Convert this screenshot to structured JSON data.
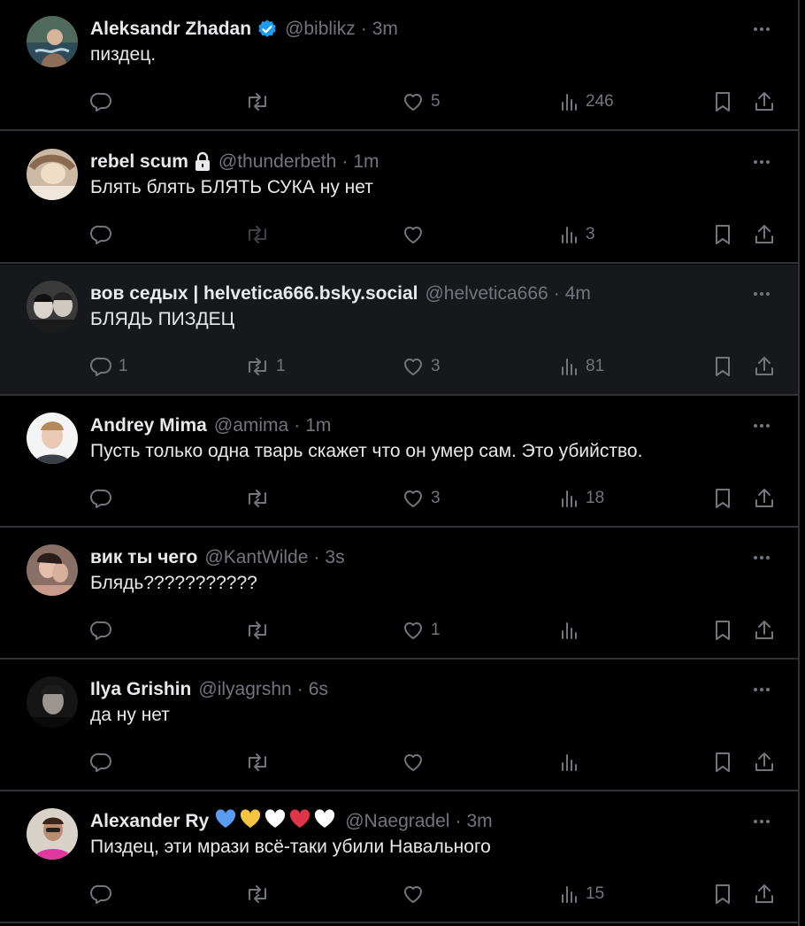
{
  "tweets": [
    {
      "name": "Aleksandr Zhadan",
      "badge": "verified",
      "handle": "@biblikz",
      "time": "3m",
      "text": "пиздец.",
      "replies": "",
      "retweets": "",
      "likes": "5",
      "views": "246",
      "rt_dim": false,
      "highlighted": false
    },
    {
      "name": "rebel scum",
      "badge": "lock",
      "handle": "@thunderbeth",
      "time": "1m",
      "text": "Блять блять БЛЯТЬ СУКА ну нет",
      "replies": "",
      "retweets": "",
      "likes": "",
      "views": "3",
      "rt_dim": true,
      "highlighted": false
    },
    {
      "name": "вов седых | helvetica666.bsky.social",
      "badge": "",
      "handle": "@helvetica666",
      "time": "4m",
      "text": "БЛЯДЬ ПИЗДЕЦ",
      "replies": "1",
      "retweets": "1",
      "likes": "3",
      "views": "81",
      "rt_dim": false,
      "highlighted": true
    },
    {
      "name": "Andrey Mima",
      "badge": "",
      "handle": "@amima",
      "time": "1m",
      "text": "Пусть только одна тварь скажет что он умер сам. Это убийство.",
      "replies": "",
      "retweets": "",
      "likes": "3",
      "views": "18",
      "rt_dim": false,
      "highlighted": false
    },
    {
      "name": "вик ты чего",
      "badge": "",
      "handle": "@KantWilde",
      "time": "3s",
      "text": "Блядь???????????",
      "replies": "",
      "retweets": "",
      "likes": "1",
      "views": "",
      "rt_dim": false,
      "highlighted": false
    },
    {
      "name": "Ilya Grishin",
      "badge": "",
      "handle": "@ilyagrshn",
      "time": "6s",
      "text": "да ну нет",
      "replies": "",
      "retweets": "",
      "likes": "",
      "views": "",
      "rt_dim": false,
      "highlighted": false
    },
    {
      "name": "Alexander Ry",
      "badge": "hearts",
      "handle": "@Naegradel",
      "time": "3m",
      "text": "Пиздец, эти мрази всё-таки убили Навального",
      "replies": "",
      "retweets": "",
      "likes": "",
      "views": "15",
      "rt_dim": false,
      "highlighted": false
    }
  ],
  "heart_colors": [
    "#5b9cf3",
    "#f5c542",
    "#ffffff",
    "#e0344a",
    "#ffffff"
  ],
  "colors": {
    "text": "#e7e9ea",
    "muted": "#71767b",
    "divider": "#2f3336",
    "verified": "#1d9bf0",
    "highlight_bg": "#16181c"
  },
  "icons": [
    "reply-icon",
    "retweet-icon",
    "like-icon",
    "views-icon",
    "bookmark-icon",
    "share-icon",
    "more-icon",
    "verified-badge-icon",
    "lock-icon"
  ]
}
